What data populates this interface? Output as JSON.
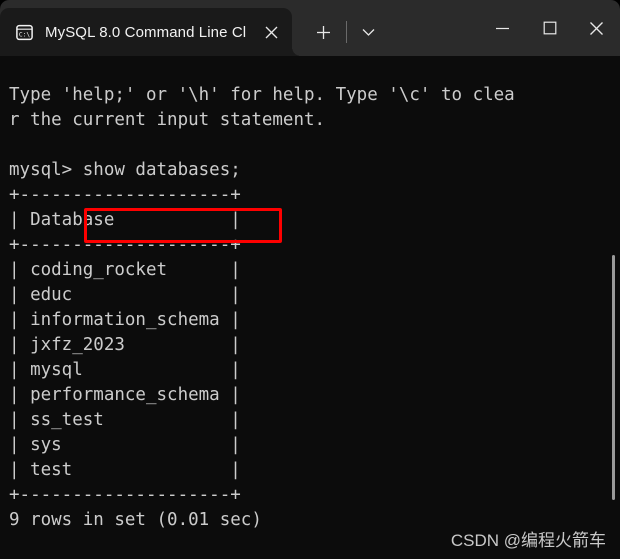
{
  "window": {
    "titlebar_color": "#2b2b2b",
    "tab_color": "#1a1a1a",
    "terminal_bg": "#0c0c0c",
    "terminal_fg": "#cccccc",
    "accent_highlight": "#fe0000"
  },
  "tab": {
    "title": "MySQL 8.0 Command Line Cl",
    "icon": "command-prompt-icon",
    "icon_label": "C:\\",
    "close_label": "×"
  },
  "tabbar": {
    "new_tab_label": "+",
    "new_tab_icon": "plus-icon",
    "dropdown_icon": "chevron-down-icon"
  },
  "window_controls": {
    "minimize_label": "—",
    "minimize_icon": "minimize-icon",
    "maximize_label": "□",
    "maximize_icon": "maximize-icon",
    "close_label": "✕",
    "close_icon": "close-icon"
  },
  "terminal": {
    "lines": [
      "Type 'help;' or '\\h' for help. Type '\\c' to clea",
      "r the current input statement.",
      "",
      "mysql> show databases;",
      "+--------------------+",
      "| Database           |",
      "+--------------------+",
      "| coding_rocket      |",
      "| educ               |",
      "| information_schema |",
      "| jxfz_2023          |",
      "| mysql              |",
      "| performance_schema |",
      "| ss_test            |",
      "| sys                |",
      "| test               |",
      "+--------------------+",
      "9 rows in set (0.01 sec)"
    ],
    "prompt": "mysql>",
    "command": "show databases;",
    "table": {
      "header": "Database",
      "rows": [
        "coding_rocket",
        "educ",
        "information_schema",
        "jxfz_2023",
        "mysql",
        "performance_schema",
        "ss_test",
        "sys",
        "test"
      ],
      "row_count": 9
    },
    "result_status": "9 rows in set (0.01 sec)",
    "help_text_line1": "Type 'help;' or '\\h' for help. Type '\\c' to clea",
    "help_text_line2": "r the current input statement."
  },
  "annotation": {
    "highlight_target": "show databases;",
    "color": "#fe0000"
  },
  "watermark": {
    "text": "CSDN @编程火箭车"
  }
}
